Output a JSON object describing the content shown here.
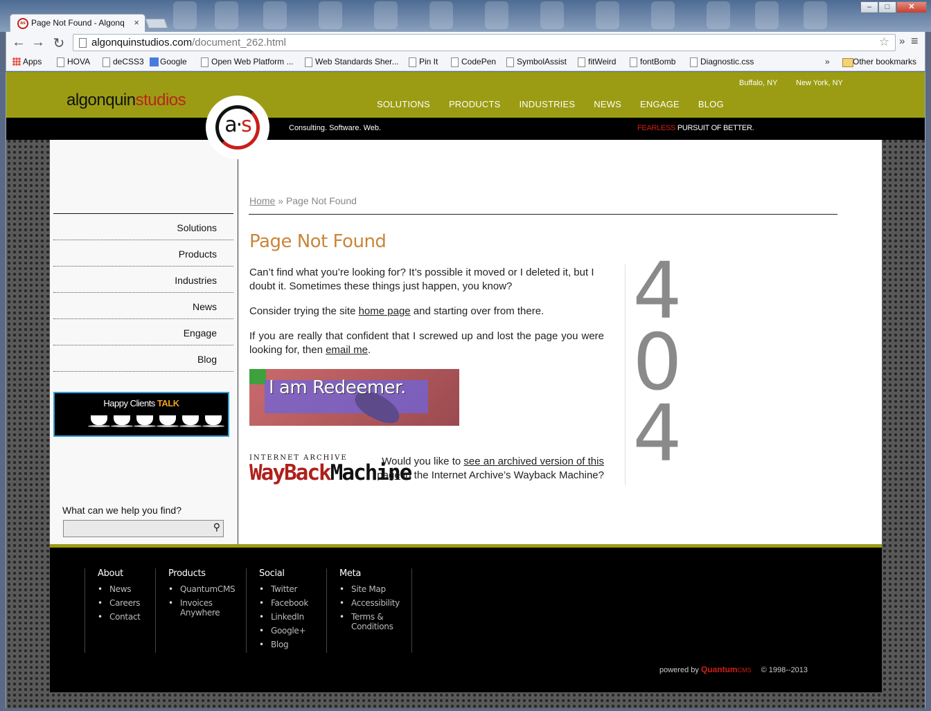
{
  "browser": {
    "tab_title": "Page Not Found - Algonq",
    "tab_close": "×",
    "url_host": "algonquinstudios.com",
    "url_path": "/document_262.html",
    "back": "←",
    "forward": "→",
    "reload": "↻",
    "star": "☆",
    "more": "»",
    "menu": "≡",
    "win_min": "–",
    "win_max": "□",
    "win_close": "✕",
    "bookmarks": [
      "Apps",
      "HOVA",
      "deCSS3",
      "Google",
      "Open Web Platform ...",
      "Web Standards Sher...",
      "Pin It",
      "CodePen",
      "SymbolAssist",
      "fitWeird",
      "fontBomb",
      "Diagnostic.css"
    ],
    "bookmarks_more": "»",
    "other_bookmarks": "Other bookmarks"
  },
  "header": {
    "logo_a": "algonquin",
    "logo_b": "studios",
    "cities": [
      "Buffalo, NY",
      "New York, NY"
    ],
    "nav": [
      "SOLUTIONS",
      "PRODUCTS",
      "INDUSTRIES",
      "NEWS",
      "ENGAGE",
      "BLOG"
    ],
    "tagline": "Consulting. Software. Web.",
    "fearless_red": "FEARLESS",
    "fearless_rest": " PURSUIT OF BETTER.",
    "badge_a": "a",
    "badge_dot": "·",
    "badge_s": "s"
  },
  "sidebar": {
    "menu": [
      "Solutions",
      "Products",
      "Industries",
      "News",
      "Engage",
      "Blog"
    ],
    "happy_a": "Happy Clients ",
    "happy_b": "TALK",
    "search_label": "What can we help you find?",
    "search_icon": "⚲"
  },
  "main": {
    "crumb_home": "Home",
    "crumb_sep": " » ",
    "crumb_current": "Page Not Found",
    "title": "Page Not Found",
    "p1": "Can’t find what you’re looking for? It’s possible it moved or I deleted it, but I doubt it. Sometimes these things just happen, you know?",
    "p2_a": "Consider trying the site ",
    "p2_link": "home page",
    "p2_b": " and starting over from there.",
    "p3_a": "If you are really that confident that I screwed up and lost the page you were looking for, then ",
    "p3_link": "email me",
    "p3_b": ".",
    "redeemer": "I am Redeemer.",
    "wayback_ia": "INTERNET ARCHIVE",
    "wayback_w": "WayBack",
    "wayback_m": "Machine",
    "wb_a": "Would you like to ",
    "wb_link": "see an archived version of this page",
    "wb_b": " in the Internet Archive’s Wayback Machine?",
    "big_digits": [
      "4",
      "0",
      "4"
    ]
  },
  "footer": {
    "columns": [
      {
        "title": "About",
        "items": [
          "News",
          "Careers",
          "Contact"
        ]
      },
      {
        "title": "Products",
        "items": [
          "QuantumCMS",
          "Invoices Anywhere"
        ]
      },
      {
        "title": "Social",
        "items": [
          "Twitter",
          "Facebook",
          "LinkedIn",
          "Google+",
          "Blog"
        ]
      },
      {
        "title": "Meta",
        "items": [
          "Site Map",
          "Accessibility",
          "Terms & Conditions"
        ]
      }
    ],
    "powered_by": "powered by ",
    "q_brand": "Quantum",
    "q_cms": "CMS",
    "copyright": "© 1998--2013"
  },
  "colors": {
    "olive": "#9b9c13",
    "accent_red": "#d01f16",
    "title_orange": "#c8863a",
    "happy_border": "#2da0d9"
  }
}
